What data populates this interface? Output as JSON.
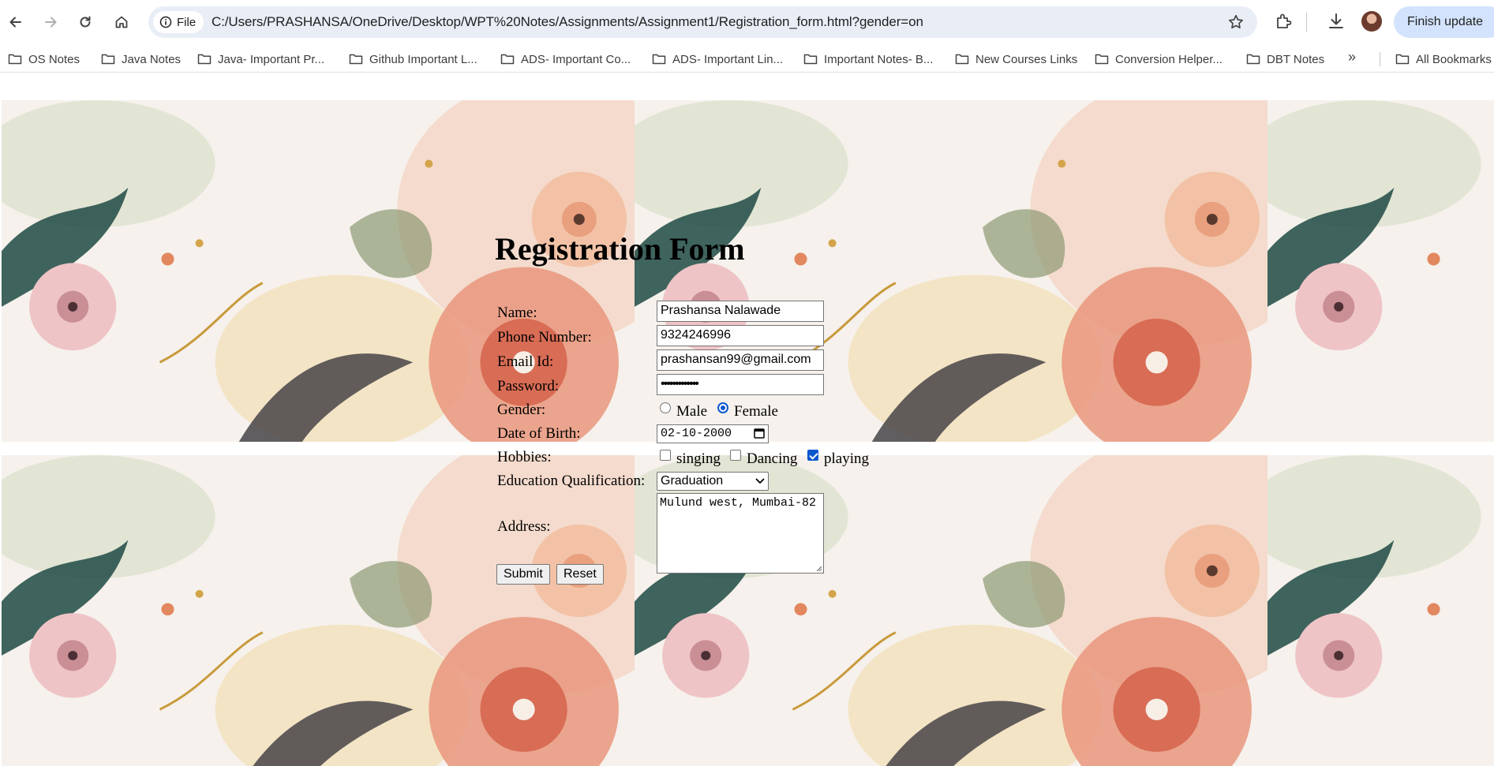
{
  "browser": {
    "site_chip": "File",
    "url": "C:/Users/PRASHANSA/OneDrive/Desktop/WPT%20Notes/Assignments/Assignment1/Registration_form.html?gender=on",
    "update_button": "Finish update",
    "bookmarks": [
      "OS Notes",
      "Java Notes",
      "Java- Important Pr...",
      "Github Important L...",
      "ADS- Important Co...",
      "ADS- Important Lin...",
      "Important Notes- B...",
      "New Courses Links",
      "Conversion Helper...",
      "DBT Notes"
    ],
    "overflow": "»",
    "all_bookmarks": "All Bookmarks"
  },
  "form": {
    "title": "Registration Form",
    "name_label": "Name:",
    "name_value": "Prashansa Nalawade",
    "phone_label": "Phone Number:",
    "phone_value": "9324246996",
    "email_label": "Email Id:",
    "email_value": "prashansan99@gmail.com",
    "password_label": "Password:",
    "password_value": "•••••••••••••",
    "gender_label": "Gender:",
    "gender_options": [
      "Male",
      "Female"
    ],
    "gender_selected": "Female",
    "dob_label": "Date of Birth:",
    "dob_value": "02-10-2000",
    "hobbies_label": "Hobbies:",
    "hobbies": [
      "singing",
      "Dancing",
      "playing"
    ],
    "hobbies_checked": [
      "playing"
    ],
    "education_label": "Education Qualification:",
    "education_value": "Graduation",
    "address_label": "Address:",
    "address_value": "Mulund west, Mumbai-82",
    "submit": "Submit",
    "reset": "Reset"
  },
  "colors": {
    "accent": "#0b57d0",
    "omnibox": "#e9eef6",
    "update_button": "#d3e3fd"
  }
}
